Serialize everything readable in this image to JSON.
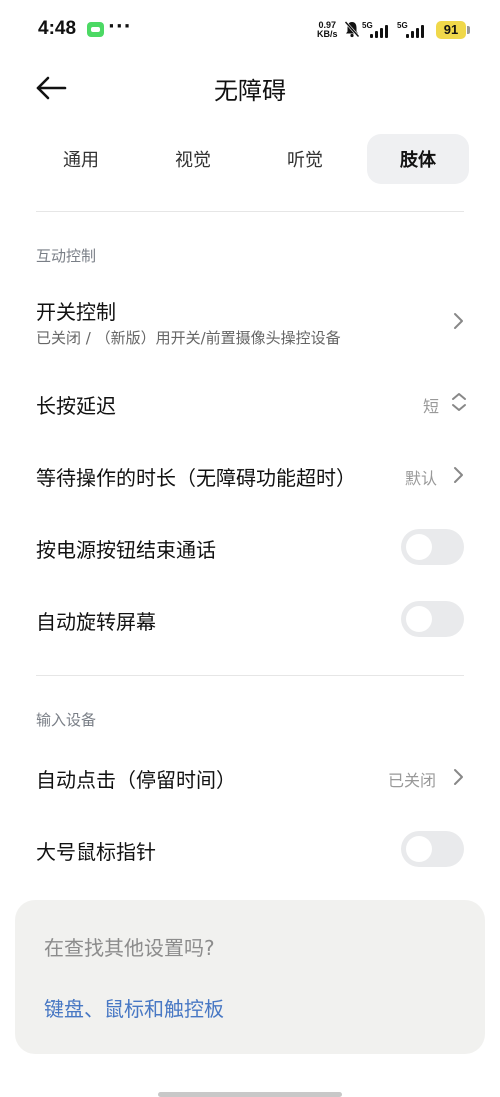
{
  "status_bar": {
    "time": "4:48",
    "dots": "···",
    "net_speed_value": "0.97",
    "net_speed_unit": "KB/s",
    "sim1_label": "5G",
    "sim2_label": "5G",
    "battery": "91",
    "battery_color": "#f0d84a"
  },
  "header": {
    "title": "无障碍"
  },
  "tabs": [
    {
      "label": "通用",
      "active": false
    },
    {
      "label": "视觉",
      "active": false
    },
    {
      "label": "听觉",
      "active": false
    },
    {
      "label": "肢体",
      "active": true
    }
  ],
  "sections": {
    "interaction": {
      "title": "互动控制",
      "switch_control": {
        "title": "开关控制",
        "subtitle": "已关闭 / （新版）用开关/前置摄像头操控设备"
      },
      "long_press": {
        "title": "长按延迟",
        "value": "短"
      },
      "wait_time": {
        "title": "等待操作的时长（无障碍功能超时）",
        "value": "默认"
      },
      "power_end_call": {
        "title": "按电源按钮结束通话",
        "on": false
      },
      "auto_rotate": {
        "title": "自动旋转屏幕",
        "on": false
      }
    },
    "input": {
      "title": "输入设备",
      "auto_click": {
        "title": "自动点击（停留时间）",
        "value": "已关闭"
      },
      "large_pointer": {
        "title": "大号鼠标指针",
        "on": false
      }
    }
  },
  "suggestion_card": {
    "question": "在查找其他设置吗?",
    "link": "键盘、鼠标和触控板",
    "link_color": "#4878c4"
  }
}
